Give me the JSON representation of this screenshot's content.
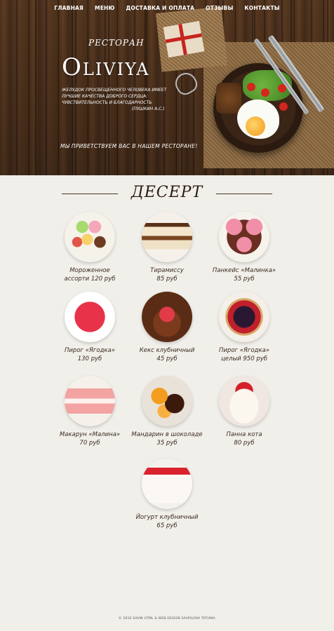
{
  "nav": {
    "items": [
      "ГЛАВНАЯ",
      "МЕНЮ",
      "ДОСТАВКА И ОПЛАТА",
      "ОТЗЫВЫ",
      "КОНТАКТЫ"
    ]
  },
  "hero": {
    "subtitle": "РЕСТОРАН",
    "brand": "Oliviya",
    "quote": "ЖЕЛУДОК ПРОСВЕЩЕННОГО ЧЕЛОВЕКА ИМЕЕТ ЛУЧШИЕ КАЧЕСТВА ДОБРОГО СЕРДЦА: ЧУВСТВИТЕЛЬНОСТЬ И БЛАГОДАРНОСТЬ",
    "quote_author": "(ПУШКИН А.С.)",
    "welcome": "МЫ ПРИВЕТСТВУЕМ ВАС В НАШЕМ РЕСТОРАНЕ!"
  },
  "section": {
    "title": "ДЕСЕРТ"
  },
  "items": [
    {
      "name": "Мороженное",
      "name2": "ассорти",
      "price": "120 руб",
      "icon": "ice-cream-photo"
    },
    {
      "name": "Тирамиссу",
      "name2": "",
      "price": "85 руб",
      "icon": "tiramisu-photo"
    },
    {
      "name": "Панкейс «Малинка»",
      "name2": "",
      "price": "55 руб",
      "icon": "pancakes-photo"
    },
    {
      "name": "Пирог «Ягодка»",
      "name2": "",
      "price": "130 руб",
      "icon": "berry-pie-slice-photo"
    },
    {
      "name": "Кекс клубничный",
      "name2": "",
      "price": "45 руб",
      "icon": "strawberry-cupcake-photo"
    },
    {
      "name": "Пирог «Ягодка»",
      "name2": "целый",
      "price": "950 руб",
      "icon": "berry-pie-whole-photo"
    },
    {
      "name": "Макарун «Малина»",
      "name2": "",
      "price": "70 руб",
      "icon": "macaron-photo"
    },
    {
      "name": "Мандарин в шоколаде",
      "name2": "",
      "price": "35 руб",
      "icon": "mandarin-chocolate-photo"
    },
    {
      "name": "Панна котa",
      "name2": "",
      "price": "80 руб",
      "icon": "panna-cotta-photo"
    },
    {
      "name": "Йогурт клубничный",
      "name2": "",
      "price": "65 руб",
      "icon": "strawberry-yogurt-photo"
    }
  ],
  "footer": {
    "text": "© 2016 SAVIN HTML & WEB DESIGN SAVRILOVA TATIANA"
  }
}
